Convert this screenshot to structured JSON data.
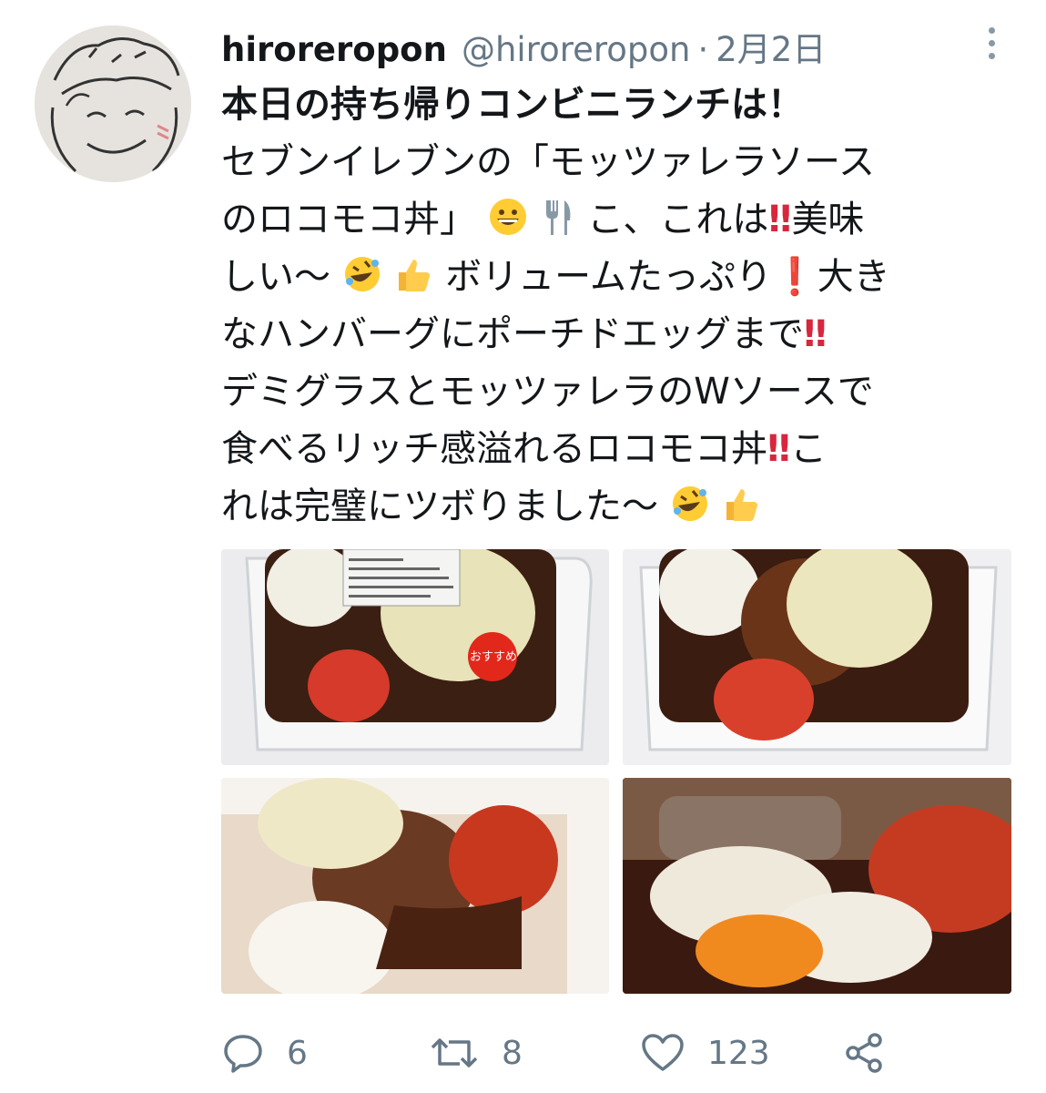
{
  "tweet": {
    "display_name": "hiroreropon",
    "handle": "@hiroreropon",
    "separator": "·",
    "date": "2月2日",
    "body_lines": [
      "本日の持ち帰りコンビニランチは！",
      "セブンイレブンの「モッツァレラソース",
      "のロコモコ丼」",
      "しい〜",
      "なハンバーグにポーチドエッグまで",
      "デミグラスとモッツァレラのWソースで",
      "食べるリッチ感溢れるロコモコ丼",
      "れは完璧にツボりました〜"
    ],
    "body_fragments": {
      "l3_after": "こ、これは",
      "l3_end": "美味",
      "l4_mid": "ボリュームたっぷり",
      "l4_end": "大き",
      "l7_end": "こ"
    },
    "emoji": {
      "grin": "grinning-face",
      "fork": "fork-and-knife",
      "bangbang": "‼",
      "bang": "❗",
      "rofl": "rolling-on-floor-laughing",
      "thumbs": "thumbs-up"
    },
    "photo_sticker": "おすすめ"
  },
  "actions": {
    "reply_count": "6",
    "retweet_count": "8",
    "like_count": "123"
  },
  "colors": {
    "secondary_text": "#657786",
    "primary_text": "#14171a",
    "icon": "#657786"
  }
}
